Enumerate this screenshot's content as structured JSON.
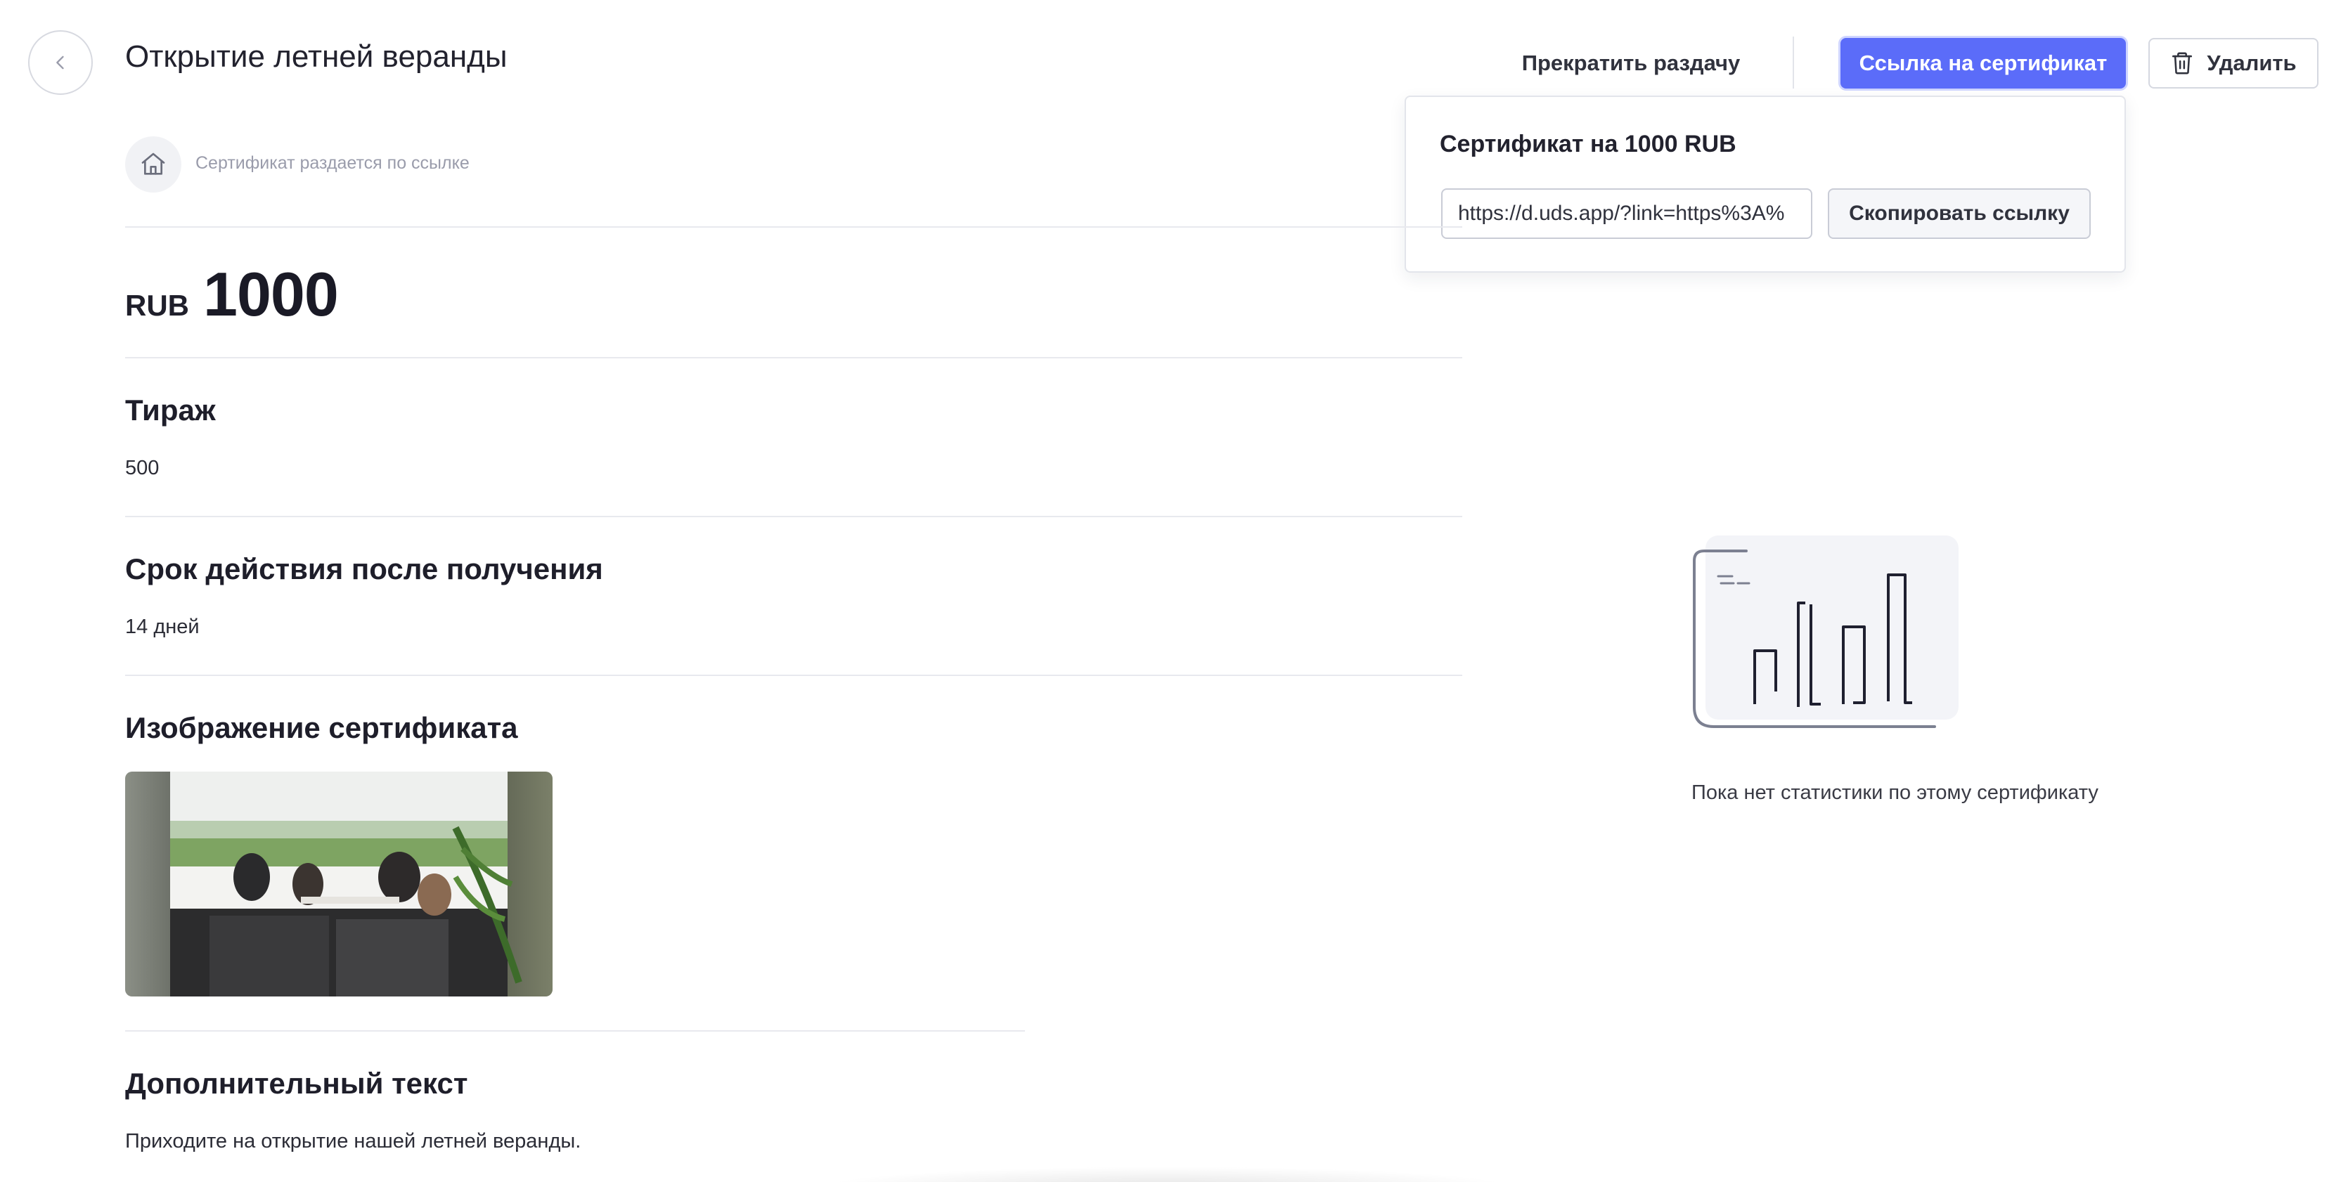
{
  "header": {
    "title": "Открытие летней веранды",
    "back_icon": "chevron-left-icon",
    "stop_label": "Прекратить раздачу",
    "link_label": "Ссылка на сертификат",
    "delete_label": "Удалить",
    "delete_icon": "trash-icon",
    "accent_color": "#5b6cf9"
  },
  "popover": {
    "title": "Сертификат на 1000 RUB",
    "link_value": "https://d.uds.app/?link=https%3A%",
    "copy_label": "Скопировать ссылку"
  },
  "info": {
    "icon": "home-icon",
    "text": "Сертификат раздается по ссылке"
  },
  "price": {
    "currency": "RUB",
    "amount": "1000"
  },
  "sections": {
    "circulation": {
      "title": "Тираж",
      "value": "500"
    },
    "validity": {
      "title": "Срок действия после получения",
      "value": "14 дней"
    },
    "image": {
      "title": "Изображение сертификата"
    },
    "extra": {
      "title": "Дополнительный текст",
      "value": "Приходите на открытие нашей летней веранды."
    }
  },
  "stats": {
    "icon": "bar-chart-illustration",
    "empty_text": "Пока нет статистики по этому сертификату"
  }
}
